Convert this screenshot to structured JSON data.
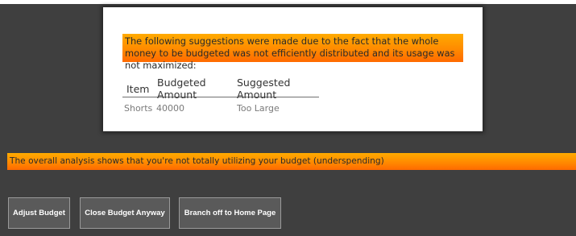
{
  "suggestions": {
    "banner_text": "The following suggestions were made due to the fact that the whole money to be budgeted was not efficiently distributed and its usage was not maximized:",
    "table": {
      "headers": [
        "Item",
        "Budgeted Amount",
        "Suggested Amount"
      ],
      "rows": [
        [
          "Shorts",
          "40000",
          "Too Large"
        ]
      ]
    }
  },
  "analysis": {
    "text": "The overall analysis shows that you're not totally utilizing your budget (underspending)"
  },
  "buttons": {
    "adjust_label": "Adjust Budget",
    "close_label": "Close Budget Anyway",
    "home_label": "Branch off to Home Page"
  },
  "colors": {
    "banner_top": "#ffab00",
    "banner_bottom": "#ff6a00",
    "background": "#3f3f3f",
    "button_bg": "#5a5a5a"
  }
}
